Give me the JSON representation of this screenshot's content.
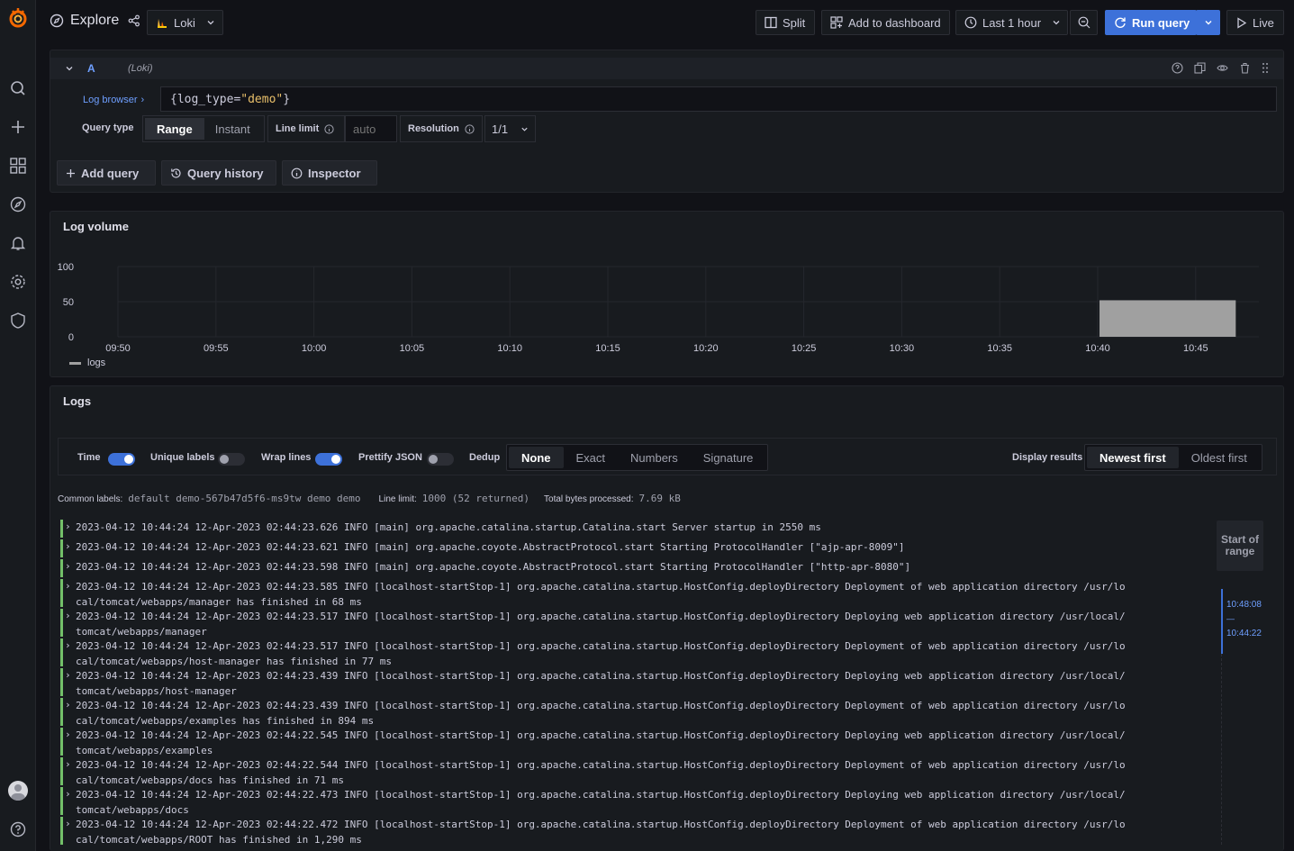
{
  "topbar": {
    "title": "Explore",
    "datasource": "Loki",
    "split": "Split",
    "add_to_dashboard": "Add to dashboard",
    "time_range": "Last 1 hour",
    "run_query": "Run query",
    "live": "Live"
  },
  "query": {
    "ref_id": "A",
    "datasource_hint": "(Loki)",
    "log_browser": "Log browser",
    "expr_prefix": "{log_type=",
    "expr_value": "\"demo\"",
    "expr_suffix": "}",
    "query_type_label": "Query type",
    "query_types": [
      "Range",
      "Instant"
    ],
    "line_limit_label": "Line limit",
    "line_limit_placeholder": "auto",
    "resolution_label": "Resolution",
    "resolution_value": "1/1",
    "add_query": "Add query",
    "query_history": "Query history",
    "inspector": "Inspector"
  },
  "log_volume": {
    "title": "Log volume",
    "legend": "logs"
  },
  "chart_data": {
    "type": "bar",
    "title": "Log volume",
    "x_ticks": [
      "09:50",
      "09:55",
      "10:00",
      "10:05",
      "10:10",
      "10:15",
      "10:20",
      "10:25",
      "10:30",
      "10:35",
      "10:40",
      "10:45"
    ],
    "y_ticks": [
      "100",
      "50",
      "0"
    ],
    "ylim": [
      0,
      100
    ],
    "series": [
      {
        "name": "logs",
        "bars": [
          {
            "x_start": "10:40",
            "x_end": "10:47",
            "value": 52
          }
        ]
      }
    ],
    "grid": true,
    "legend_position": "bottom-left",
    "color": "#a0a0a0"
  },
  "logs": {
    "title": "Logs",
    "time": "Time",
    "unique_labels": "Unique labels",
    "wrap_lines": "Wrap lines",
    "prettify_json": "Prettify JSON",
    "dedup": "Dedup",
    "dedup_options": [
      "None",
      "Exact",
      "Numbers",
      "Signature"
    ],
    "display_results": "Display results",
    "order_options": [
      "Newest first",
      "Oldest first"
    ],
    "common_labels_label": "Common labels:",
    "common_labels": "default demo-567b47d5f6-ms9tw demo demo",
    "line_limit_label": "Line limit:",
    "line_limit_value": "1000 (52 returned)",
    "bytes_label": "Total bytes processed:",
    "bytes_value": "7.69 kB",
    "range_start": "Start of range",
    "range_top": "10:48:08",
    "range_dash": "—",
    "range_bottom": "10:44:22",
    "rows": [
      {
        "l1": "2023-04-12 10:44:24 12-Apr-2023 02:44:23.626 INFO [main] org.apache.catalina.startup.Catalina.start Server startup in 2550 ms",
        "l2": ""
      },
      {
        "l1": "2023-04-12 10:44:24 12-Apr-2023 02:44:23.621 INFO [main] org.apache.coyote.AbstractProtocol.start Starting ProtocolHandler [\"ajp-apr-8009\"]",
        "l2": ""
      },
      {
        "l1": "2023-04-12 10:44:24 12-Apr-2023 02:44:23.598 INFO [main] org.apache.coyote.AbstractProtocol.start Starting ProtocolHandler [\"http-apr-8080\"]",
        "l2": ""
      },
      {
        "l1": "2023-04-12 10:44:24 12-Apr-2023 02:44:23.585 INFO [localhost-startStop-1] org.apache.catalina.startup.HostConfig.deployDirectory Deployment of web application directory /usr/lo",
        "l2": "cal/tomcat/webapps/manager has finished in 68 ms"
      },
      {
        "l1": "2023-04-12 10:44:24 12-Apr-2023 02:44:23.517 INFO [localhost-startStop-1] org.apache.catalina.startup.HostConfig.deployDirectory Deploying web application directory /usr/local/",
        "l2": "tomcat/webapps/manager"
      },
      {
        "l1": "2023-04-12 10:44:24 12-Apr-2023 02:44:23.517 INFO [localhost-startStop-1] org.apache.catalina.startup.HostConfig.deployDirectory Deployment of web application directory /usr/lo",
        "l2": "cal/tomcat/webapps/host-manager has finished in 77 ms"
      },
      {
        "l1": "2023-04-12 10:44:24 12-Apr-2023 02:44:23.439 INFO [localhost-startStop-1] org.apache.catalina.startup.HostConfig.deployDirectory Deploying web application directory /usr/local/",
        "l2": "tomcat/webapps/host-manager"
      },
      {
        "l1": "2023-04-12 10:44:24 12-Apr-2023 02:44:23.439 INFO [localhost-startStop-1] org.apache.catalina.startup.HostConfig.deployDirectory Deployment of web application directory /usr/lo",
        "l2": "cal/tomcat/webapps/examples has finished in 894 ms"
      },
      {
        "l1": "2023-04-12 10:44:24 12-Apr-2023 02:44:22.545 INFO [localhost-startStop-1] org.apache.catalina.startup.HostConfig.deployDirectory Deploying web application directory /usr/local/",
        "l2": "tomcat/webapps/examples"
      },
      {
        "l1": "2023-04-12 10:44:24 12-Apr-2023 02:44:22.544 INFO [localhost-startStop-1] org.apache.catalina.startup.HostConfig.deployDirectory Deployment of web application directory /usr/lo",
        "l2": "cal/tomcat/webapps/docs has finished in 71 ms"
      },
      {
        "l1": "2023-04-12 10:44:24 12-Apr-2023 02:44:22.473 INFO [localhost-startStop-1] org.apache.catalina.startup.HostConfig.deployDirectory Deploying web application directory /usr/local/",
        "l2": "tomcat/webapps/docs"
      },
      {
        "l1": "2023-04-12 10:44:24 12-Apr-2023 02:44:22.472 INFO [localhost-startStop-1] org.apache.catalina.startup.HostConfig.deployDirectory Deployment of web application directory /usr/lo",
        "l2": "cal/tomcat/webapps/ROOT has finished in 1,290 ms"
      }
    ]
  }
}
